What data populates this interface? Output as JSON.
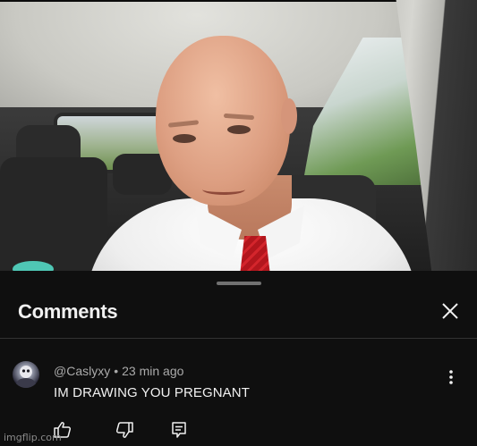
{
  "video": {
    "description_icon": "video-frame-image"
  },
  "comments_panel": {
    "title": "Comments",
    "close_icon": "close-icon",
    "comments": [
      {
        "author": "@Caslyxy",
        "separator": "•",
        "time": "23 min ago",
        "text": "IM DRAWING YOU PREGNANT",
        "avatar_icon": "avatar",
        "more_icon": "more-vertical-icon",
        "actions": [
          "thumbs-up-icon",
          "thumbs-down-icon",
          "reply-icon"
        ]
      }
    ]
  },
  "watermark": "imgflip.com"
}
